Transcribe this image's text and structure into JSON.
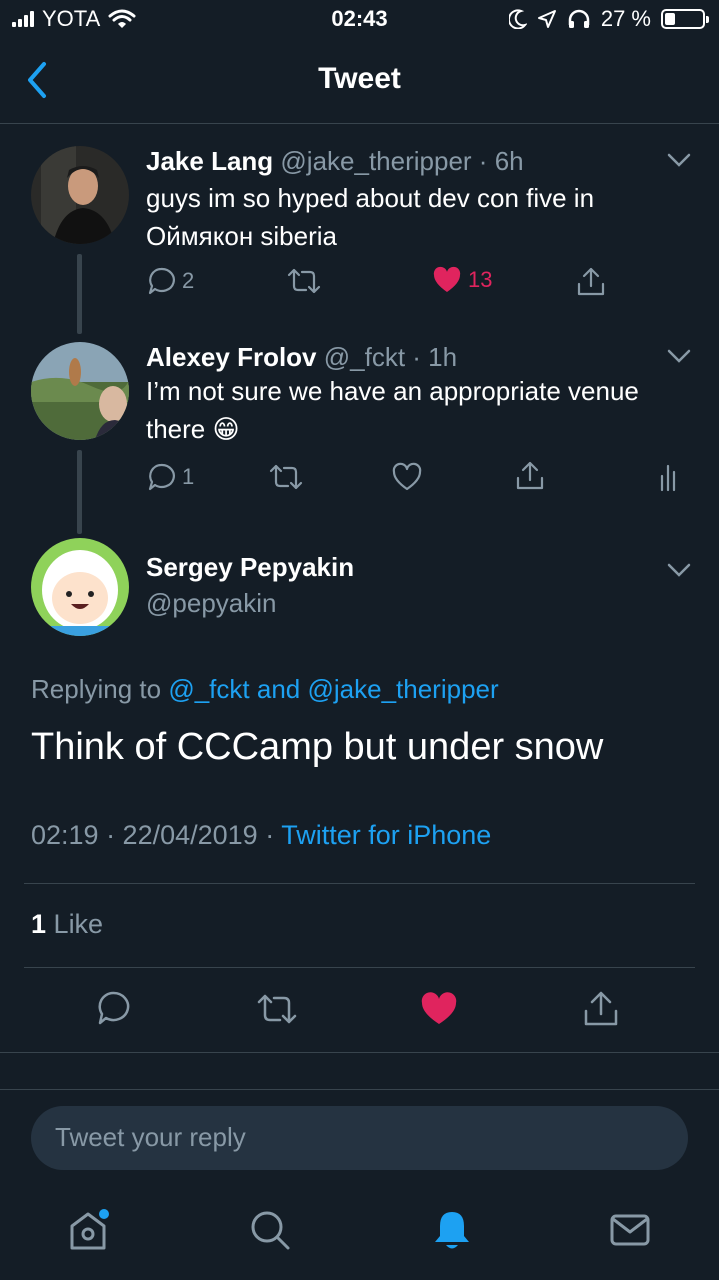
{
  "status_bar": {
    "carrier": "YOTA",
    "time": "02:43",
    "battery_percent": "27 %",
    "battery_level": 0.27
  },
  "nav": {
    "title": "Tweet"
  },
  "tweets": [
    {
      "name": "Jake Lang",
      "handle": "@jake_theripper",
      "time": "6h",
      "text": "guys im so hyped about dev con five in Оймякон siberia",
      "replies": "2",
      "likes": "13",
      "liked": true
    },
    {
      "name": "Alexey Frolov",
      "handle": "@_fckt",
      "time": "1h",
      "text": "I’m not sure we have an appropriate venue there",
      "emoji": "😁",
      "replies": "1"
    }
  ],
  "main_tweet": {
    "name": "Sergey Pepyakin",
    "handle": "@pepyakin",
    "replying_prefix": "Replying to",
    "reply_to_1": "@_fckt",
    "reply_and": "and",
    "reply_to_2": "@jake_theripper",
    "text": "Think of CCCamp but under snow",
    "timestamp": "02:19 · 22/04/2019 ·",
    "source": "Twitter for iPhone",
    "like_count": "1",
    "like_label": "Like"
  },
  "reply_input": {
    "placeholder": "Tweet your reply"
  },
  "colors": {
    "background": "#141d26",
    "accent": "#1da1f2",
    "like": "#e0245e",
    "muted": "#8899a6"
  }
}
